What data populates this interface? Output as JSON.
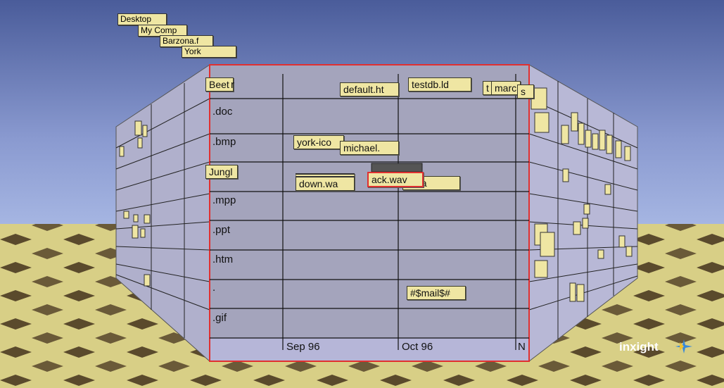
{
  "breadcrumb": [
    "Desktop",
    "My Comp",
    "Barzona.f",
    "York"
  ],
  "categories": [
    "Beet",
    ".doc",
    ".bmp",
    "Jungl",
    ".mpp",
    ".ppt",
    ".htm",
    ".",
    ".gif"
  ],
  "time_axis": [
    "Sep 96",
    "Oct 96",
    "N"
  ],
  "files": {
    "default": "default.ht",
    "testdb": "testdb.ld",
    "t_short": "t",
    "marc": "marc",
    "s_short": "s",
    "york_ico": "york-ico",
    "michael": "michael.",
    "down_wav": "down.wa",
    "ack_wav": "ack.wav",
    "e_wav": "e.wa",
    "mail": "#$mail$#",
    "r_short": "r"
  },
  "logo": "inxight",
  "colors": {
    "highlight": "#e03030",
    "label_bg": "#efe6a3",
    "wall_front": "#a4a4bc",
    "wall_side": "#b4b4d0"
  }
}
